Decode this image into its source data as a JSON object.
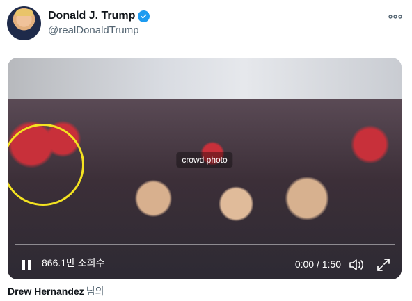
{
  "account": {
    "name": "Donald J. Trump",
    "handle": "@realDonaldTrump",
    "verified": true
  },
  "video": {
    "views": "866.1만 조회수",
    "time": "0:00 / 1:50",
    "progress": 0.0,
    "placeholder": "crowd photo"
  },
  "credit": {
    "author": "Drew Hernandez",
    "suffix": "님의"
  },
  "icons": [
    "more-icon",
    "verified-icon",
    "pause-icon",
    "volume-icon",
    "fullscreen-icon"
  ],
  "colors": {
    "verified": "#1d9bf0",
    "highlight": "#f4e321"
  }
}
